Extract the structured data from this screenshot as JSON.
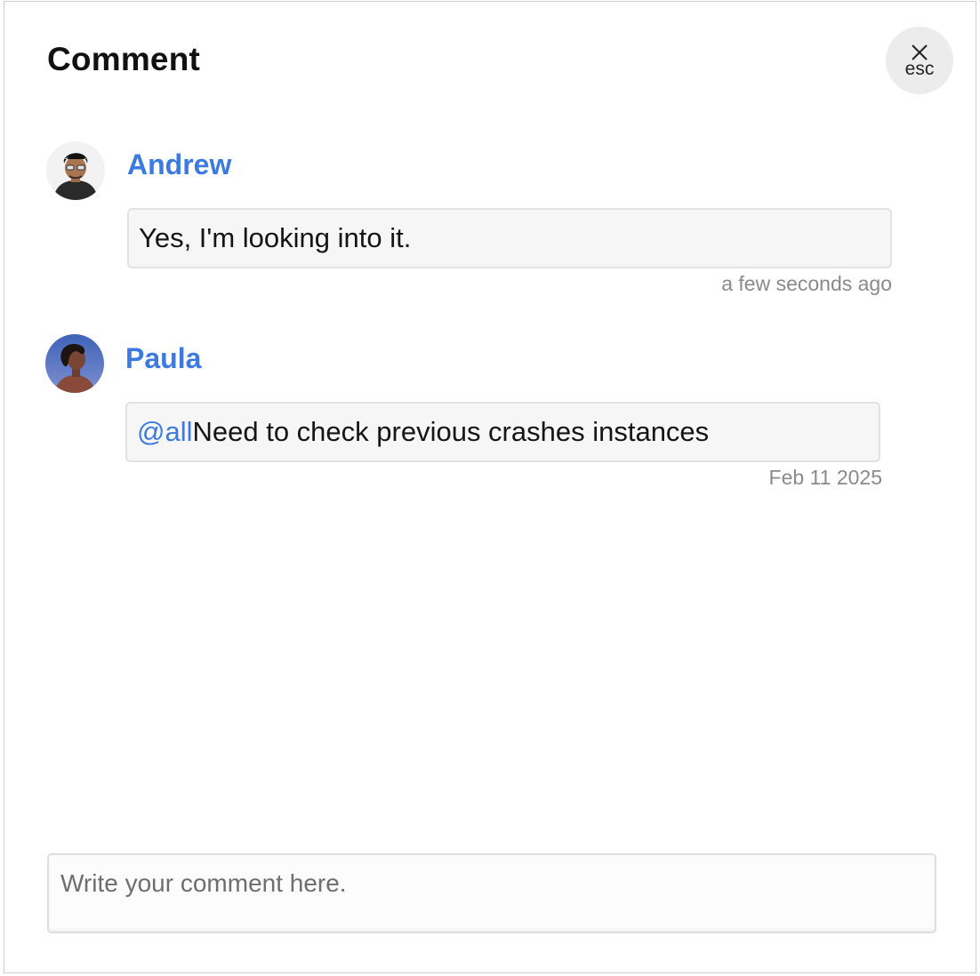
{
  "header": {
    "title": "Comment",
    "close_label": "esc"
  },
  "comments": [
    {
      "author": "Andrew",
      "mention": "",
      "text": "Yes, I'm looking into it.",
      "time": "a few seconds ago",
      "avatar_icon": "user-avatar-andrew"
    },
    {
      "author": "Paula",
      "mention": "@all",
      "text": "Need to check previous crashes instances",
      "time": "Feb 11 2025",
      "avatar_icon": "user-avatar-paula"
    }
  ],
  "composer": {
    "placeholder": "Write your comment here."
  },
  "colors": {
    "accent": "#3b7ae0",
    "bubble_bg": "#f6f6f6",
    "close_bg": "#ececec"
  }
}
